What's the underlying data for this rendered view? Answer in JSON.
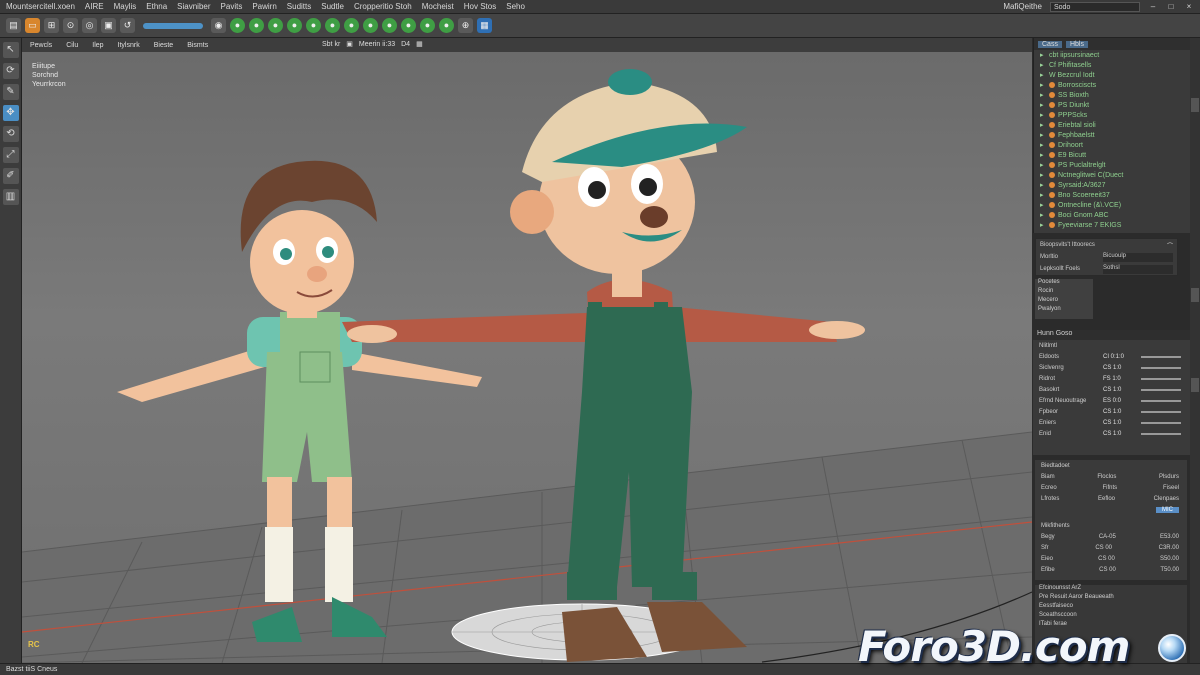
{
  "menubar": {
    "items": [
      "Mountsercitell.xoen",
      "AIRE",
      "Maylis",
      "Ethna",
      "Siavniber",
      "Pavits",
      "Pawirn",
      "Suditts",
      "Sudtle",
      "Cropperitio Stoh",
      "Mocheist",
      "Hov Stos",
      "Seho"
    ],
    "search_value": "Sodo",
    "right_label": "MafiQeithe"
  },
  "viewport": {
    "menu": [
      "Pewcls",
      "Cilu",
      "Ilep",
      "Itylsnrk",
      "Bieste",
      "Bismts"
    ],
    "toolbar": [
      "Sbt kr",
      "Meerin ii:33",
      "D4"
    ],
    "hud": [
      "Eiiitupe",
      "Sorchnd",
      "Yeurrkrcon"
    ],
    "axis_label": "RC"
  },
  "outliner": {
    "tabs": [
      "Cass",
      "Hbls"
    ],
    "rows": [
      "cbt iipsursinaect",
      "Cf Phifitasells",
      "W Bezcrul Iodt",
      "Borrosciscts",
      "SS Bioxth",
      "PS Diunkt",
      "PPPScks",
      "Eriebtal sioli",
      "Fephbaelstt",
      "Drihoort",
      "E9 Bicutt",
      "PS Puclaltrelglt",
      "Nctneglitwei C(Duect",
      "Syrsaid:A/3627",
      "Bno Scoereeit37",
      "Ontnecline (&\\.VCE)",
      "Boci Gnom ABC",
      "Fyeeviarse 7 EKIGS"
    ]
  },
  "attr1": {
    "rows": [
      {
        "label": "Bioopsvits't Ittoorecs",
        "value": ""
      },
      {
        "label": "Morltio",
        "value": "Bicuoulp"
      },
      {
        "label": "Lepksollt Foels",
        "value": "Sothsl"
      }
    ]
  },
  "attr2": {
    "rows": [
      "Pocetes",
      "Rocin",
      "Mecero",
      "Pwalyon"
    ]
  },
  "channel": {
    "header": "Hunn",
    "tab": "Goso",
    "section": "Nlitlmtl",
    "rows": [
      {
        "k": "Eldoots",
        "v": "CI 0:1:0"
      },
      {
        "k": "Siclvenrg",
        "v": "CS 1:0"
      },
      {
        "k": "Ridrot",
        "v": "FS 1:0"
      },
      {
        "k": "Basokrt",
        "v": "CS 1:0"
      },
      {
        "k": "Efrnd Neuoutrage",
        "v": "ES 0:0"
      },
      {
        "k": "Fpbeor",
        "v": "CS 1:0"
      },
      {
        "k": "Eniers",
        "v": "CS 1:0"
      },
      {
        "k": "Enid",
        "v": "CS 1:0"
      }
    ]
  },
  "props": {
    "header": "Biedtadoet",
    "rows": [
      {
        "k": "Biam",
        "v": "Floclos",
        "r": "Plsdurs"
      },
      {
        "k": "Ecreo",
        "v": "Fifnts",
        "r": "Fiseel"
      },
      {
        "k": "Lfrotes",
        "v": "Eefloo",
        "r": "Clenpaes"
      }
    ],
    "button": "MIC"
  },
  "props2": {
    "header": "Mikfithents",
    "rows": [
      {
        "k": "Begy",
        "v": "CA-05",
        "r": "E53.00"
      },
      {
        "k": "Sfr",
        "v": "CS 00",
        "r": "C3R.00"
      },
      {
        "k": "Eieo",
        "v": "CS 00",
        "r": "S50.00"
      },
      {
        "k": "Efibe",
        "v": "CS 00",
        "r": "T50.00"
      }
    ]
  },
  "props3": {
    "header": "Efcinounsst",
    "tab": "ArZ",
    "rows": [
      "Pre Resuit Aaror Beaueeath",
      "Eesstfaiseco",
      "Sceathsccoon",
      "ITabi ferae"
    ]
  },
  "statusbar": {
    "text": "Bazst tiiS Cneus"
  },
  "watermark": {
    "text": "Foro3D.com"
  },
  "colors": {
    "accent": "#4a8ec4",
    "viewport_bg": "#707070",
    "outliner_text": "#8fd08f"
  }
}
